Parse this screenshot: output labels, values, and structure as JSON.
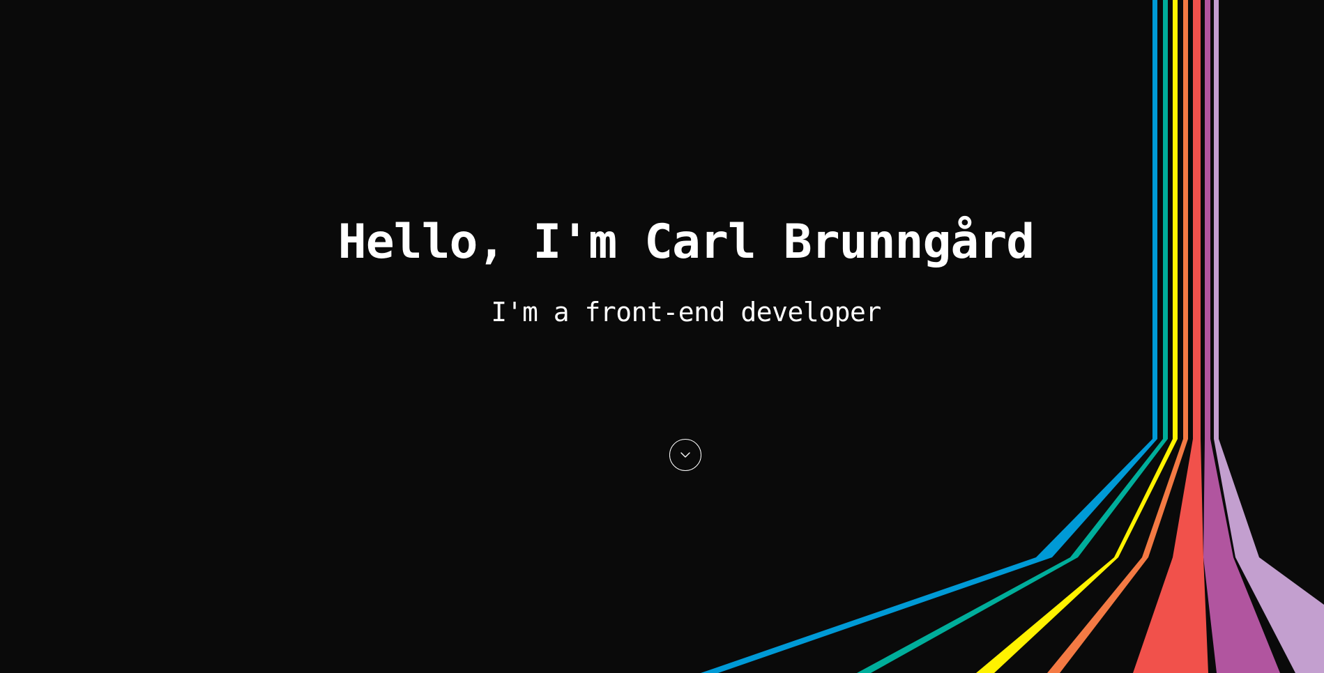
{
  "hero": {
    "title": "Hello, I'm Carl Brunngård",
    "subtitle": "I'm a front-end developer",
    "scroll_icon": "chevron-down-icon"
  },
  "colors": {
    "background": "#0a0a0a",
    "text": "#ffffff",
    "stripes": [
      "#009ad6",
      "#00ae9b",
      "#fff200",
      "#f47a44",
      "#f1514b",
      "#b1559f",
      "#c39fcf"
    ]
  }
}
